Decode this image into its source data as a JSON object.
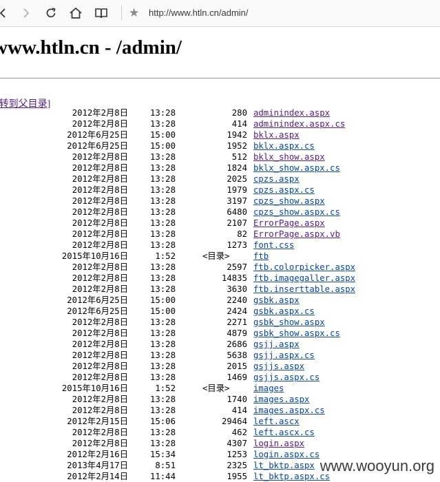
{
  "browser": {
    "url": "http://www.htln.cn/admin/",
    "icons": [
      "back-icon",
      "forward-icon",
      "reload-icon",
      "home-icon",
      "reader-view-icon",
      "bookmark-star-icon"
    ]
  },
  "page": {
    "heading": "www.htln.cn - /admin/",
    "parent_link": "[转到父目录]",
    "dir_marker": "<目录>",
    "link_colors": {
      "unvisited": "#0645ad",
      "visited": "#551a8b"
    }
  },
  "entries": [
    {
      "date": "2012年2月8日",
      "time": "13:28",
      "size": "280",
      "name": "adminindex.aspx",
      "visited": true
    },
    {
      "date": "2012年2月8日",
      "time": "13:28",
      "size": "414",
      "name": "adminindex.aspx.cs",
      "visited": true
    },
    {
      "date": "2012年6月25日",
      "time": "15:00",
      "size": "1942",
      "name": "bklx.aspx",
      "visited": true
    },
    {
      "date": "2012年6月25日",
      "time": "15:00",
      "size": "1952",
      "name": "bklx.aspx.cs",
      "visited": false
    },
    {
      "date": "2012年2月8日",
      "time": "13:28",
      "size": "512",
      "name": "bklx_show.aspx",
      "visited": true
    },
    {
      "date": "2012年2月8日",
      "time": "13:28",
      "size": "1824",
      "name": "bklx_show.aspx.cs",
      "visited": false
    },
    {
      "date": "2012年2月8日",
      "time": "13:28",
      "size": "2025",
      "name": "cpzs.aspx",
      "visited": false
    },
    {
      "date": "2012年2月8日",
      "time": "13:28",
      "size": "1979",
      "name": "cpzs.aspx.cs",
      "visited": false
    },
    {
      "date": "2012年2月8日",
      "time": "13:28",
      "size": "3197",
      "name": "cpzs_show.aspx",
      "visited": false
    },
    {
      "date": "2012年2月8日",
      "time": "13:28",
      "size": "6480",
      "name": "cpzs_show.aspx.cs",
      "visited": false
    },
    {
      "date": "2012年2月8日",
      "time": "13:28",
      "size": "2107",
      "name": "ErrorPage.aspx",
      "visited": true
    },
    {
      "date": "2012年2月8日",
      "time": "13:28",
      "size": "82",
      "name": "ErrorPage.aspx.vb",
      "visited": true
    },
    {
      "date": "2012年2月8日",
      "time": "13:28",
      "size": "1273",
      "name": "font.css",
      "visited": false
    },
    {
      "date": "2015年10月16日",
      "time": "1:52",
      "size": "",
      "dir": true,
      "name": "ftb",
      "visited": false
    },
    {
      "date": "2012年2月8日",
      "time": "13:28",
      "size": "2597",
      "name": "ftb.colorpicker.aspx",
      "visited": false
    },
    {
      "date": "2012年2月8日",
      "time": "13:28",
      "size": "14835",
      "name": "ftb.imagegaller.aspx",
      "visited": false
    },
    {
      "date": "2012年2月8日",
      "time": "13:28",
      "size": "3630",
      "name": "ftb.inserttable.aspx",
      "visited": false
    },
    {
      "date": "2012年6月25日",
      "time": "15:00",
      "size": "2240",
      "name": "gsbk.aspx",
      "visited": false
    },
    {
      "date": "2012年6月25日",
      "time": "15:00",
      "size": "2424",
      "name": "gsbk.aspx.cs",
      "visited": false
    },
    {
      "date": "2012年2月8日",
      "time": "13:28",
      "size": "2271",
      "name": "gsbk_show.aspx",
      "visited": false
    },
    {
      "date": "2012年2月8日",
      "time": "13:28",
      "size": "4879",
      "name": "gsbk_show.aspx.cs",
      "visited": false
    },
    {
      "date": "2012年2月8日",
      "time": "13:28",
      "size": "2686",
      "name": "gsjj.aspx",
      "visited": false
    },
    {
      "date": "2012年2月8日",
      "time": "13:28",
      "size": "5638",
      "name": "gsjj.aspx.cs",
      "visited": false
    },
    {
      "date": "2012年2月8日",
      "time": "13:28",
      "size": "2015",
      "name": "gsjjs.aspx",
      "visited": false
    },
    {
      "date": "2012年2月8日",
      "time": "13:28",
      "size": "1469",
      "name": "gsjjs.aspx.cs",
      "visited": false
    },
    {
      "date": "2015年10月16日",
      "time": "1:52",
      "size": "",
      "dir": true,
      "name": "images",
      "visited": false
    },
    {
      "date": "2012年2月8日",
      "time": "13:28",
      "size": "1740",
      "name": "images.aspx",
      "visited": false
    },
    {
      "date": "2012年2月8日",
      "time": "13:28",
      "size": "414",
      "name": "images.aspx.cs",
      "visited": false
    },
    {
      "date": "2012年2月15日",
      "time": "15:06",
      "size": "29464",
      "name": "left.ascx",
      "visited": false
    },
    {
      "date": "2012年2月8日",
      "time": "13:28",
      "size": "462",
      "name": "left.ascx.cs",
      "visited": false
    },
    {
      "date": "2012年2月8日",
      "time": "13:28",
      "size": "4307",
      "name": "login.aspx",
      "visited": true
    },
    {
      "date": "2012年2月16日",
      "time": "15:34",
      "size": "1253",
      "name": "login.aspx.cs",
      "visited": false
    },
    {
      "date": "2013年4月17日",
      "time": "8:51",
      "size": "2325",
      "name": "lt_bktp.aspx",
      "visited": false
    },
    {
      "date": "2012年2月14日",
      "time": "11:44",
      "size": "1955",
      "name": "lt_bktp.aspx.cs",
      "visited": false
    }
  ],
  "watermark": "www.wooyun.org"
}
